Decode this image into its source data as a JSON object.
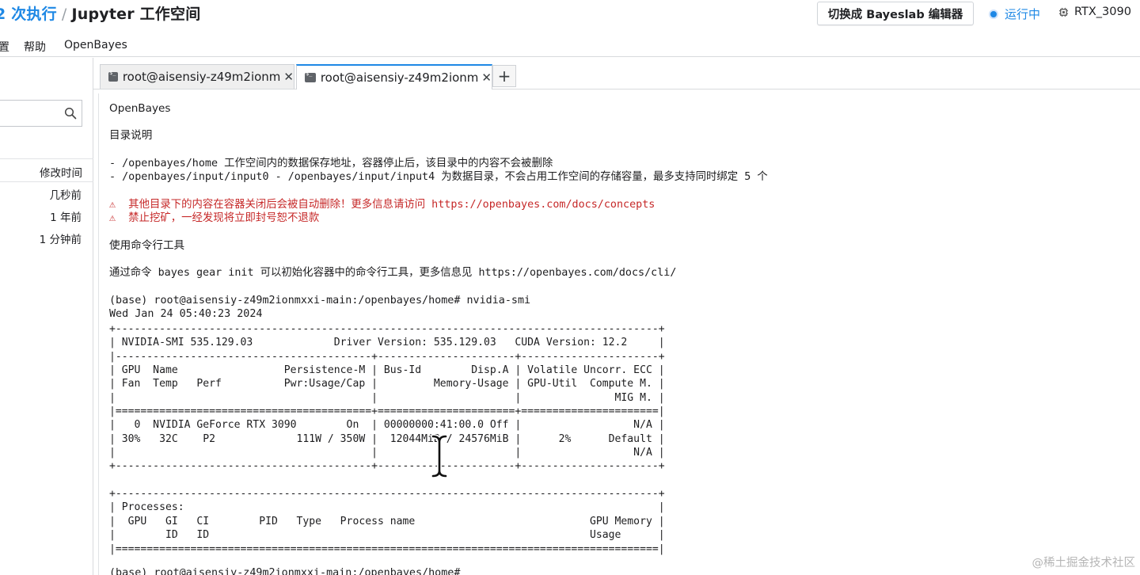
{
  "header": {
    "run_text": "2 次执行",
    "separator": "/",
    "workspace_title": "Jupyter 工作空间",
    "switch_button": "切换成 Bayeslab 编辑器",
    "status": "运行中",
    "gpu": "RTX_3090"
  },
  "menubar": {
    "items": [
      "置",
      "帮助",
      "OpenBayes"
    ]
  },
  "file_panel": {
    "column_header": "修改时间",
    "rows": [
      {
        "time": "几秒前"
      },
      {
        "time": "1 年前"
      },
      {
        "time": "1 分钟前"
      }
    ]
  },
  "tabs": [
    {
      "label": "root@aisensiy-z49m2ionm",
      "close": "✕",
      "active": false
    },
    {
      "label": "root@aisensiy-z49m2ionm",
      "close": "✕",
      "active": true
    }
  ],
  "tab_add": "+",
  "terminal": {
    "lines": [
      "OpenBayes",
      "目录说明",
      "- /openbayes/home 工作空间内的数据保存地址，容器停止后，该目录中的内容不会被删除",
      "- /openbayes/input/input0 - /openbayes/input/input4 为数据目录，不会占用工作空间的存储容量，最多支持同时绑定 5 个",
      "⚠  其他目录下的内容在容器关闭后会被自动删除！更多信息请访问 https://openbayes.com/docs/concepts",
      "⚠  禁止挖矿，一经发现将立即封号恕不退款",
      "使用命令行工具",
      "通过命令 bayes gear init 可以初始化容器中的命令行工具，更多信息见 https://openbayes.com/docs/cli/",
      "(base) root@aisensiy-z49m2ionmxxi-main:/openbayes/home# nvidia-smi",
      "Wed Jan 24 05:40:23 2024",
      "(base) root@aisensiy-z49m2ionmxxi-main:/openbayes/home#"
    ],
    "smi_output": "+---------------------------------------------------------------------------------------+\n| NVIDIA-SMI 535.129.03             Driver Version: 535.129.03   CUDA Version: 12.2     |\n|-----------------------------------------+----------------------+----------------------+\n| GPU  Name                 Persistence-M | Bus-Id        Disp.A | Volatile Uncorr. ECC |\n| Fan  Temp   Perf          Pwr:Usage/Cap |         Memory-Usage | GPU-Util  Compute M. |\n|                                         |                      |               MIG M. |\n|=========================================+======================+======================|\n|   0  NVIDIA GeForce RTX 3090        On  | 00000000:41:00.0 Off |                  N/A |\n| 30%   32C    P2             111W / 350W |  12044MiB / 24576MiB |      2%      Default |\n|                                         |                      |                  N/A |\n+-----------------------------------------+----------------------+----------------------+\n\n+---------------------------------------------------------------------------------------+\n| Processes:                                                                            |\n|  GPU   GI   CI        PID   Type   Process name                            GPU Memory |\n|        ID   ID                                                             Usage      |\n|=======================================================================================|"
  },
  "watermark": "@稀土掘金技术社区"
}
